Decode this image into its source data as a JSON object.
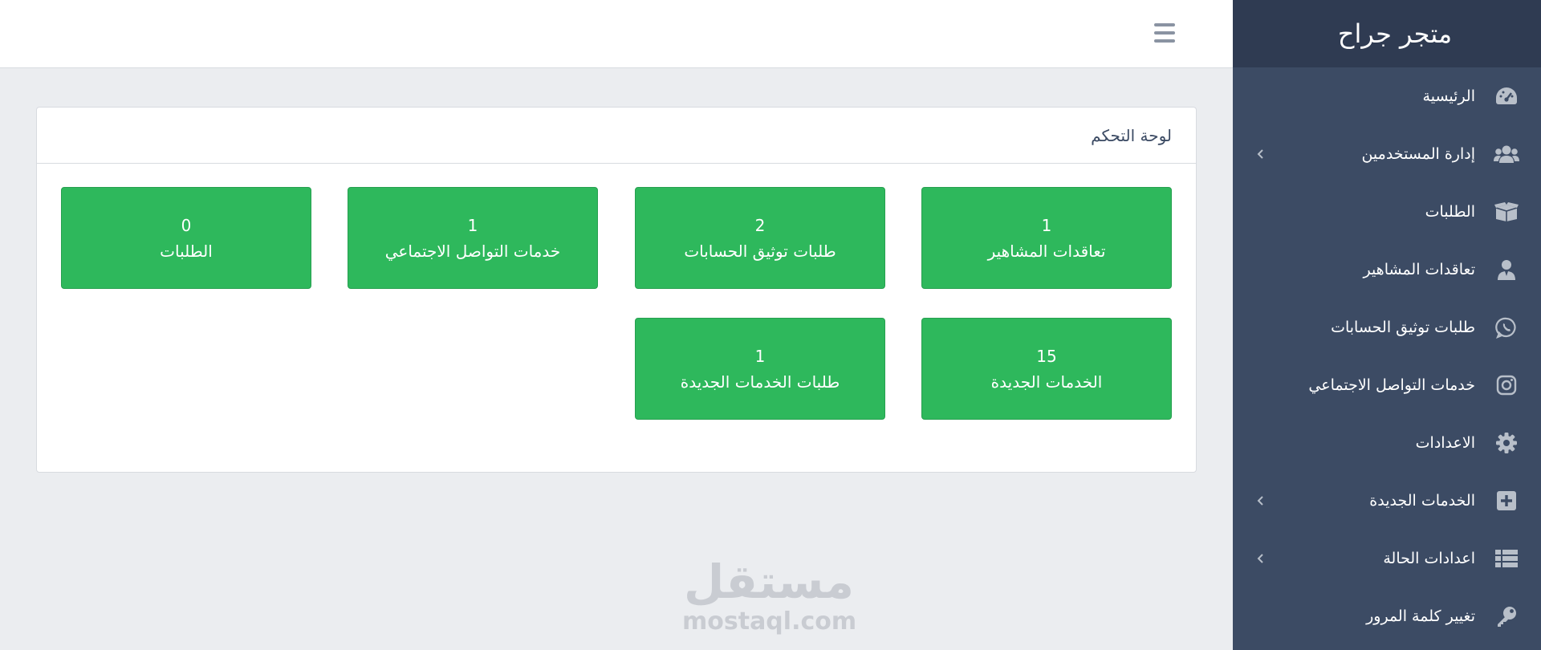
{
  "brand": "متجر جراح",
  "sidebar": {
    "items": [
      {
        "label": "الرئيسية",
        "icon": "speedometer-icon",
        "has_submenu": false
      },
      {
        "label": "إدارة المستخدمين",
        "icon": "users-icon",
        "has_submenu": true
      },
      {
        "label": "الطلبات",
        "icon": "box-icon",
        "has_submenu": false
      },
      {
        "label": "تعاقدات المشاهير",
        "icon": "user-icon",
        "has_submenu": false
      },
      {
        "label": "طلبات توثيق الحسابات",
        "icon": "whatsapp-icon",
        "has_submenu": false
      },
      {
        "label": "خدمات التواصل الاجتماعي",
        "icon": "instagram-icon",
        "has_submenu": false
      },
      {
        "label": "الاعدادات",
        "icon": "gear-icon",
        "has_submenu": false
      },
      {
        "label": "الخدمات الجديدة",
        "icon": "plus-square-icon",
        "has_submenu": true
      },
      {
        "label": "اعدادات الحالة",
        "icon": "list-icon",
        "has_submenu": true
      },
      {
        "label": "تغيير كلمة المرور",
        "icon": "key-icon",
        "has_submenu": false
      }
    ]
  },
  "card": {
    "title": "لوحة التحكم",
    "tiles": [
      {
        "count": "1",
        "label": "تعاقدات المشاهير"
      },
      {
        "count": "2",
        "label": "طلبات توثيق الحسابات"
      },
      {
        "count": "1",
        "label": "خدمات التواصل الاجتماعي"
      },
      {
        "count": "0",
        "label": "الطلبات"
      },
      {
        "count": "15",
        "label": "الخدمات الجديدة"
      },
      {
        "count": "1",
        "label": "طلبات الخدمات الجديدة"
      }
    ]
  },
  "watermark": {
    "arabic": "مستقل",
    "latin": "mostaql.com"
  },
  "colors": {
    "sidebar": "#3c4b64",
    "brand_bar": "#2f3b52",
    "tile": "#2eb85c",
    "background": "#ebedf0",
    "icon": "#b8bfc9"
  }
}
